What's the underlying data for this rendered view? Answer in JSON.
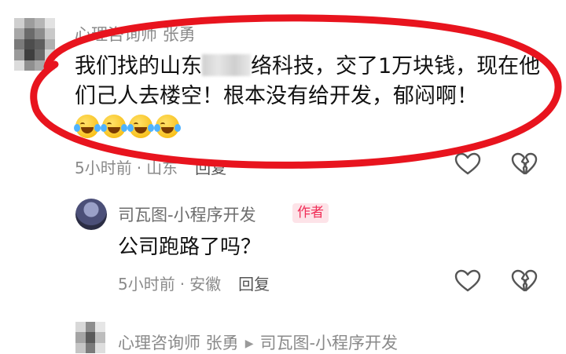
{
  "comment1": {
    "username": "心理咨询师 张勇",
    "text_part1": "我们找的山东",
    "text_part2": "络科技，交了1万块钱，现在他们己人去楼空！根本没有给开发，郁闷啊！",
    "emojis": [
      "laugh-cry-emoji",
      "laugh-cry-emoji",
      "laugh-cry-emoji",
      "laugh-cry-emoji"
    ],
    "time": "5小时前",
    "location": "山东",
    "reply_label": "回复"
  },
  "reply1": {
    "username": "司瓦图-小程序开发",
    "badge": "作者",
    "text": "公司跑路了吗？",
    "time": "5小时前",
    "location": "安徽",
    "reply_label": "回复"
  },
  "reply2": {
    "from_user": "心理咨询师 张勇",
    "to_user": "司瓦图-小程序开发"
  },
  "colors": {
    "highlight": "#e8141e",
    "badge_text": "#f02e57",
    "badge_bg": "#fde3e8",
    "meta": "#8a8a8a"
  }
}
